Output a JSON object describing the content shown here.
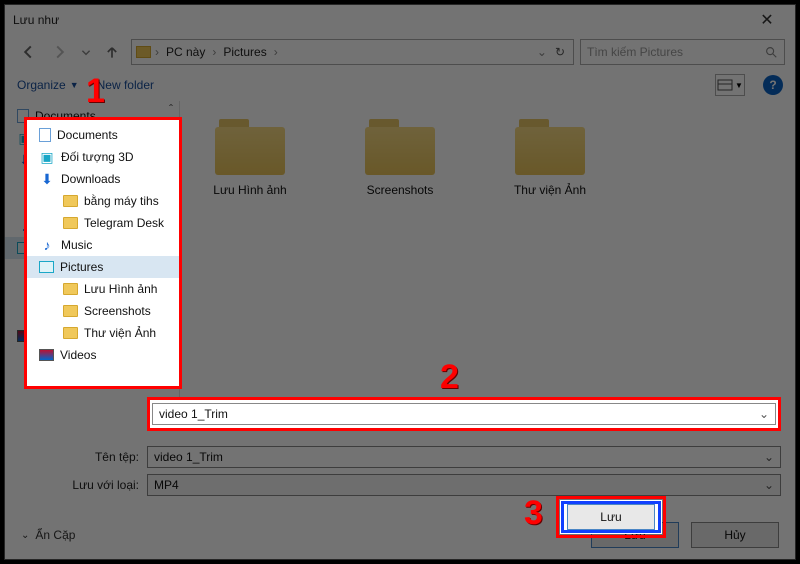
{
  "window": {
    "title": "Lưu như"
  },
  "nav": {
    "crumb1": "PC này",
    "crumb2": "Pictures",
    "search_placeholder": "Tìm kiếm Pictures"
  },
  "toolbar": {
    "organize": "Organize",
    "newfolder": "New folder"
  },
  "tree": [
    {
      "icon": "doc",
      "label": "Documents",
      "indent": false,
      "selected": false
    },
    {
      "icon": "cube",
      "label": "Đối tượng 3D",
      "indent": false,
      "selected": false
    },
    {
      "icon": "dl",
      "label": "Downloads",
      "indent": false,
      "selected": false
    },
    {
      "icon": "folder",
      "label": "bằng máy tihs",
      "indent": true,
      "selected": false
    },
    {
      "icon": "folder",
      "label": "Telegram Desk",
      "indent": true,
      "selected": false
    },
    {
      "icon": "music",
      "label": "Music",
      "indent": false,
      "selected": false
    },
    {
      "icon": "pic",
      "label": "Pictures",
      "indent": false,
      "selected": true
    },
    {
      "icon": "folder",
      "label": "Lưu Hình ảnh",
      "indent": true,
      "selected": false
    },
    {
      "icon": "folder",
      "label": "Screenshots",
      "indent": true,
      "selected": false
    },
    {
      "icon": "folder",
      "label": "Thư viện Ảnh",
      "indent": true,
      "selected": false
    },
    {
      "icon": "vid",
      "label": "Videos",
      "indent": false,
      "selected": false
    }
  ],
  "folders": [
    {
      "label": "Lưu Hình ảnh"
    },
    {
      "label": "Screenshots"
    },
    {
      "label": "Thư viện Ảnh"
    }
  ],
  "fields": {
    "filename_label": "Tên tệp:",
    "filename_value": "video 1_Trim",
    "filetype_label": "Lưu với loại:",
    "filetype_value": "MP4"
  },
  "footer": {
    "hide_folders": "Ẩn Cặp",
    "save": "Lưu",
    "cancel": "Hủy"
  },
  "annotations": {
    "n1": "1",
    "n2": "2",
    "n3": "3"
  }
}
